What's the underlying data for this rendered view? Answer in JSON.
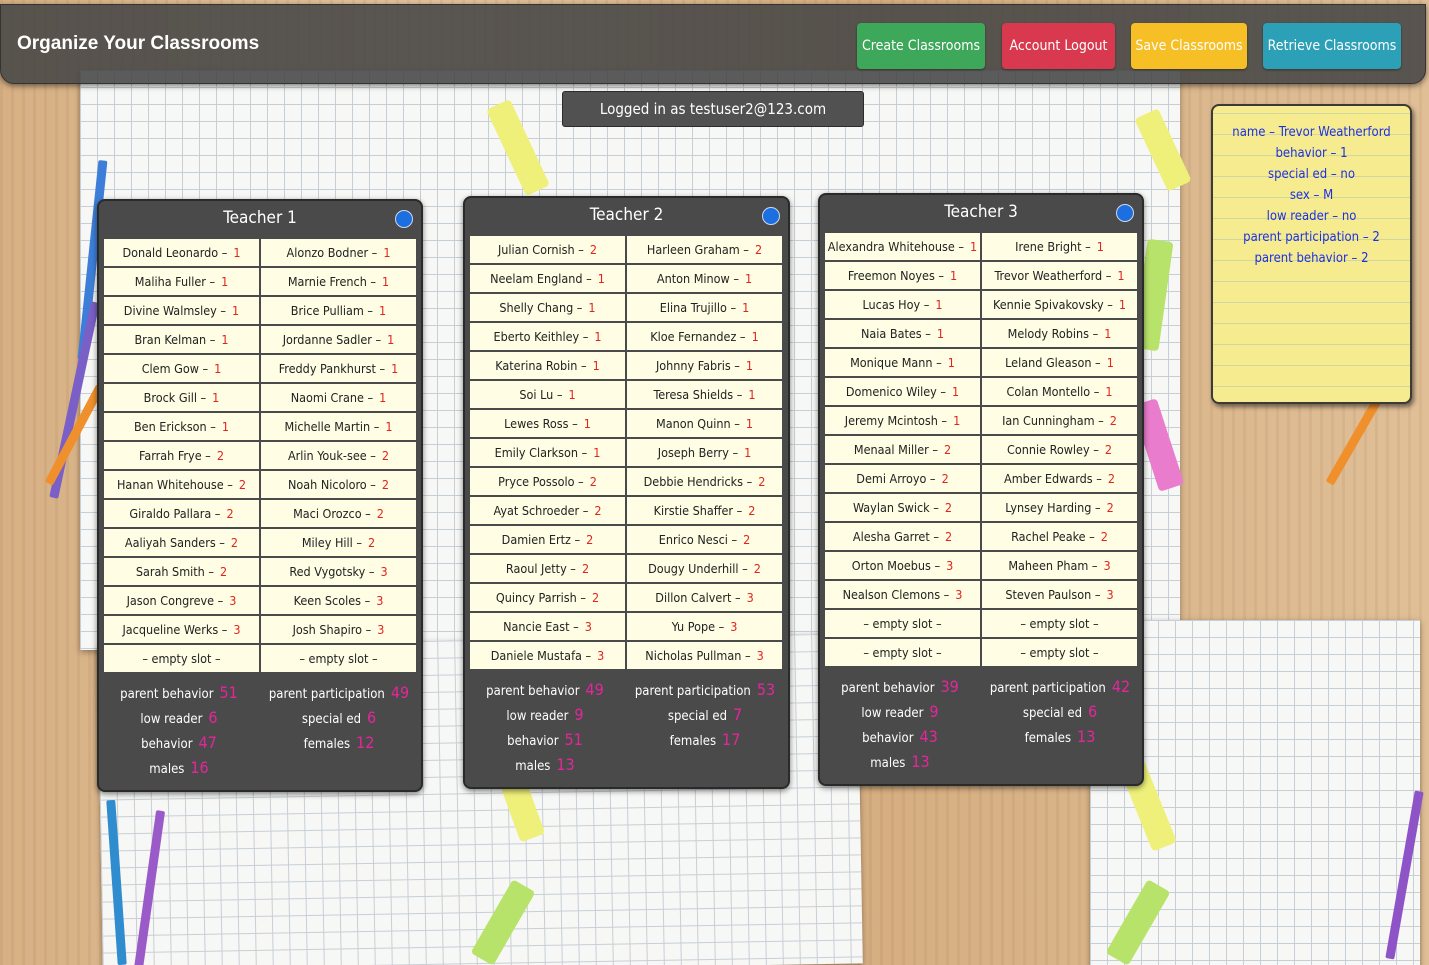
{
  "header": {
    "title": "Organize Your Classrooms",
    "buttons": {
      "create": "Create Classrooms",
      "logout": "Account Logout",
      "save": "Save Classrooms",
      "retrieve": "Retrieve Classrooms"
    }
  },
  "login_status": "Logged in as testuser2@123.com",
  "sticky_note": [
    "name – Trevor Weatherford",
    "behavior – 1",
    "special ed – no",
    "sex – M",
    "low reader – no",
    "parent participation – 2",
    "parent behavior – 2"
  ],
  "colors": {
    "create": "#3da75a",
    "logout": "#d9394e",
    "save": "#f7bf26",
    "retrieve": "#2ba0b7",
    "stat_value": "#e4269b",
    "score": "#e0241e"
  },
  "teachers": [
    {
      "title": "Teacher 1",
      "students": [
        {
          "name": "Donald Leonardo –",
          "score": "1"
        },
        {
          "name": "Alonzo Bodner –",
          "score": "1"
        },
        {
          "name": "Maliha Fuller –",
          "score": "1"
        },
        {
          "name": "Marnie French –",
          "score": "1"
        },
        {
          "name": "Divine Walmsley –",
          "score": "1"
        },
        {
          "name": "Brice Pulliam –",
          "score": "1"
        },
        {
          "name": "Bran Kelman –",
          "score": "1"
        },
        {
          "name": "Jordanne Sadler –",
          "score": "1"
        },
        {
          "name": "Clem Gow –",
          "score": "1"
        },
        {
          "name": "Freddy Pankhurst –",
          "score": "1"
        },
        {
          "name": "Brock Gill –",
          "score": "1"
        },
        {
          "name": "Naomi Crane –",
          "score": "1"
        },
        {
          "name": "Ben Erickson –",
          "score": "1"
        },
        {
          "name": "Michelle Martin –",
          "score": "1"
        },
        {
          "name": "Farrah Frye –",
          "score": "2"
        },
        {
          "name": "Arlin Youk-see –",
          "score": "2"
        },
        {
          "name": "Hanan Whitehouse –",
          "score": "2"
        },
        {
          "name": "Noah Nicoloro –",
          "score": "2"
        },
        {
          "name": "Giraldo Pallara –",
          "score": "2"
        },
        {
          "name": "Maci Orozco –",
          "score": "2"
        },
        {
          "name": "Aaliyah Sanders –",
          "score": "2"
        },
        {
          "name": "Miley Hill –",
          "score": "2"
        },
        {
          "name": "Sarah Smith –",
          "score": "2"
        },
        {
          "name": "Red Vygotsky –",
          "score": "3"
        },
        {
          "name": "Jason Congreve –",
          "score": "3"
        },
        {
          "name": "Keen Scoles –",
          "score": "3"
        },
        {
          "name": "Jacqueline Werks –",
          "score": "3"
        },
        {
          "name": "Josh Shapiro –",
          "score": "3"
        },
        {
          "name": "– empty slot –",
          "score": ""
        },
        {
          "name": "– empty slot –",
          "score": ""
        }
      ],
      "stats": {
        "parent_behavior": {
          "label": "parent behavior",
          "value": "51"
        },
        "parent_participation": {
          "label": "parent participation",
          "value": "49"
        },
        "low_reader": {
          "label": "low reader",
          "value": "6"
        },
        "special_ed": {
          "label": "special ed",
          "value": "6"
        },
        "behavior": {
          "label": "behavior",
          "value": "47"
        },
        "females": {
          "label": "females",
          "value": "12"
        },
        "males": {
          "label": "males",
          "value": "16"
        }
      }
    },
    {
      "title": "Teacher 2",
      "students": [
        {
          "name": "Julian Cornish –",
          "score": "2"
        },
        {
          "name": "Harleen Graham –",
          "score": "2"
        },
        {
          "name": "Neelam England –",
          "score": "1"
        },
        {
          "name": "Anton Minow –",
          "score": "1"
        },
        {
          "name": "Shelly Chang –",
          "score": "1"
        },
        {
          "name": "Elina Trujillo –",
          "score": "1"
        },
        {
          "name": "Eberto Keithley –",
          "score": "1"
        },
        {
          "name": "Kloe Fernandez –",
          "score": "1"
        },
        {
          "name": "Katerina Robin –",
          "score": "1"
        },
        {
          "name": "Johnny Fabris –",
          "score": "1"
        },
        {
          "name": "Soi Lu –",
          "score": "1"
        },
        {
          "name": "Teresa Shields –",
          "score": "1"
        },
        {
          "name": "Lewes Ross –",
          "score": "1"
        },
        {
          "name": "Manon Quinn –",
          "score": "1"
        },
        {
          "name": "Emily Clarkson –",
          "score": "1"
        },
        {
          "name": "Joseph Berry –",
          "score": "1"
        },
        {
          "name": "Pryce Possolo –",
          "score": "2"
        },
        {
          "name": "Debbie Hendricks –",
          "score": "2"
        },
        {
          "name": "Ayat Schroeder –",
          "score": "2"
        },
        {
          "name": "Kirstie Shaffer –",
          "score": "2"
        },
        {
          "name": "Damien Ertz –",
          "score": "2"
        },
        {
          "name": "Enrico Nesci –",
          "score": "2"
        },
        {
          "name": "Raoul Jetty –",
          "score": "2"
        },
        {
          "name": "Dougy Underhill –",
          "score": "2"
        },
        {
          "name": "Quincy Parrish –",
          "score": "2"
        },
        {
          "name": "Dillon Calvert –",
          "score": "3"
        },
        {
          "name": "Nancie East –",
          "score": "3"
        },
        {
          "name": "Yu Pope –",
          "score": "3"
        },
        {
          "name": "Daniele Mustafa –",
          "score": "3"
        },
        {
          "name": "Nicholas Pullman –",
          "score": "3"
        }
      ],
      "stats": {
        "parent_behavior": {
          "label": "parent behavior",
          "value": "49"
        },
        "parent_participation": {
          "label": "parent participation",
          "value": "53"
        },
        "low_reader": {
          "label": "low reader",
          "value": "9"
        },
        "special_ed": {
          "label": "special ed",
          "value": "7"
        },
        "behavior": {
          "label": "behavior",
          "value": "51"
        },
        "females": {
          "label": "females",
          "value": "17"
        },
        "males": {
          "label": "males",
          "value": "13"
        }
      }
    },
    {
      "title": "Teacher 3",
      "students": [
        {
          "name": "Alexandra Whitehouse –",
          "score": "1"
        },
        {
          "name": "Irene Bright –",
          "score": "1"
        },
        {
          "name": "Freemon Noyes –",
          "score": "1"
        },
        {
          "name": "Trevor Weatherford –",
          "score": "1"
        },
        {
          "name": "Lucas Hoy –",
          "score": "1"
        },
        {
          "name": "Kennie Spivakovsky –",
          "score": "1"
        },
        {
          "name": "Naia Bates –",
          "score": "1"
        },
        {
          "name": "Melody Robins –",
          "score": "1"
        },
        {
          "name": "Monique Mann –",
          "score": "1"
        },
        {
          "name": "Leland Gleason –",
          "score": "1"
        },
        {
          "name": "Domenico Wiley –",
          "score": "1"
        },
        {
          "name": "Colan Montello –",
          "score": "1"
        },
        {
          "name": "Jeremy Mcintosh –",
          "score": "1"
        },
        {
          "name": "Ian Cunningham –",
          "score": "2"
        },
        {
          "name": "Menaal Miller –",
          "score": "2"
        },
        {
          "name": "Connie Rowley –",
          "score": "2"
        },
        {
          "name": "Demi Arroyo –",
          "score": "2"
        },
        {
          "name": "Amber Edwards –",
          "score": "2"
        },
        {
          "name": "Waylan Swick –",
          "score": "2"
        },
        {
          "name": "Lynsey Harding –",
          "score": "2"
        },
        {
          "name": "Alesha Garret –",
          "score": "2"
        },
        {
          "name": "Rachel Peake –",
          "score": "2"
        },
        {
          "name": "Orton Moebus –",
          "score": "3"
        },
        {
          "name": "Maheen Pham –",
          "score": "3"
        },
        {
          "name": "Nealson Clemons –",
          "score": "3"
        },
        {
          "name": "Steven Paulson –",
          "score": "3"
        },
        {
          "name": "– empty slot –",
          "score": ""
        },
        {
          "name": "– empty slot –",
          "score": ""
        },
        {
          "name": "– empty slot –",
          "score": ""
        },
        {
          "name": "– empty slot –",
          "score": ""
        }
      ],
      "stats": {
        "parent_behavior": {
          "label": "parent behavior",
          "value": "39"
        },
        "parent_participation": {
          "label": "parent participation",
          "value": "42"
        },
        "low_reader": {
          "label": "low reader",
          "value": "9"
        },
        "special_ed": {
          "label": "special ed",
          "value": "6"
        },
        "behavior": {
          "label": "behavior",
          "value": "43"
        },
        "females": {
          "label": "females",
          "value": "13"
        },
        "males": {
          "label": "males",
          "value": "13"
        }
      }
    }
  ]
}
